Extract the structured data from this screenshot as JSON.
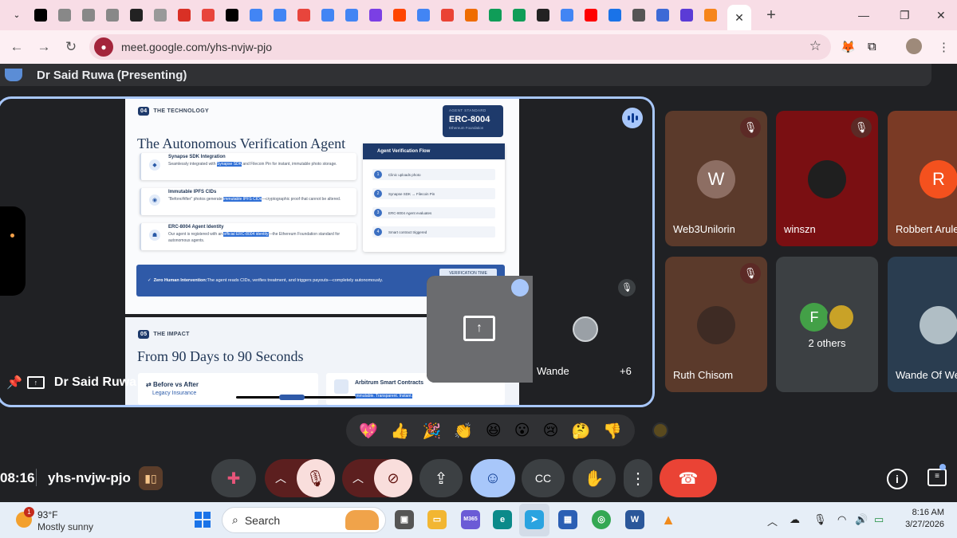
{
  "browser": {
    "url": "meet.google.com/yhs-nvjw-pjo",
    "tab_icons": [
      "chevron-down",
      "x-logo",
      "globe",
      "globe",
      "asterisk",
      "tn",
      "link",
      "a",
      "tube",
      "square",
      "doc",
      "doc",
      "tube",
      "doc",
      "doc",
      "shield",
      "reddit",
      "doc",
      "gmail",
      "chart",
      "plus",
      "plus",
      "news",
      "google",
      "youtube",
      "building",
      "globe",
      "cloud",
      "star",
      "fox"
    ],
    "close_label": "✕",
    "newtab_label": "+"
  },
  "meet": {
    "presenter_title": "Dr Said Ruwa (Presenting)",
    "stage_label": "Dr Said Ruwa",
    "self_view": {
      "name": "Wande",
      "more_count": "+6"
    },
    "participants": [
      {
        "name": "Web3Unilorin",
        "initial": "W",
        "bg": "#5b3a2b",
        "avatar_color": "#8d6e63",
        "muted": true
      },
      {
        "name": "winszn",
        "initial": "",
        "bg": "#7a0f12",
        "avatar_color": "#1f1f1f",
        "muted": true
      },
      {
        "name": "Robbert Arule",
        "initial": "R",
        "bg": "#7a3a25",
        "avatar_color": "#f4511e",
        "muted": false
      },
      {
        "name": "Ruth Chisom",
        "initial": "",
        "bg": "#5b3a2b",
        "avatar_color": "#3e2b24",
        "muted": true
      },
      {
        "name": "2 others",
        "initial": "F",
        "bg": "#3c4043",
        "avatar_color": "#43a047",
        "muted": false
      },
      {
        "name": "Wande Of We",
        "initial": "",
        "bg": "#2a3d50",
        "avatar_color": "#b0bec5",
        "muted": false
      }
    ],
    "reactions": [
      "💖",
      "👍",
      "🎉",
      "👏",
      "😆",
      "😮",
      "😢",
      "🤔",
      "👎"
    ],
    "meeting_time": "08:16",
    "meeting_code": "yhs-nvjw-pjo",
    "colors": {
      "accent": "#a8c7fa",
      "end_call": "#ea4335",
      "muted_bg": "#f9dedc",
      "active_blue": "#a8c7fa"
    }
  },
  "slide1": {
    "section_num": "04",
    "section_label": "THE TECHNOLOGY",
    "title": "The Autonomous Verification Agent",
    "badge": {
      "line1": "AGENT STANDARD",
      "line2": "ERC-8004",
      "line3": "Ethereum Foundation"
    },
    "cards": [
      {
        "title": "Synapse SDK Integration",
        "desc_pre": "Seamlessly integrated with ",
        "desc_hl": "Synapse SDK",
        "desc_post": " and Filecoin Pin for instant, immutable photo storage."
      },
      {
        "title": "Immutable IPFS CIDs",
        "desc_pre": "\"Before/After\" photos generate ",
        "desc_hl": "immutable IPFS CIDs",
        "desc_post": "—cryptographic proof that cannot be altered."
      },
      {
        "title": "ERC-8004 Agent Identity",
        "desc_pre": "Our agent is registered with an ",
        "desc_hl": "official ERC-8004 identity",
        "desc_post": "—the Ethereum Foundation standard for autonomous agents."
      }
    ],
    "flow_title": "Agent Verification Flow",
    "flow_steps": [
      "Clinic uploads photo",
      "Synapse SDK → Filecoin Pin",
      "ERC-8004 Agent evaluates",
      "Smart contract triggered"
    ],
    "banner_bold": "Zero Human Intervention:",
    "banner_text": " The agent reads CIDs, verifies treatment, and triggers payouts—completely autonomously.",
    "banner_pill": "VERIFICATION TIME"
  },
  "slide2": {
    "section_num": "05",
    "section_label": "THE IMPACT",
    "title": "From 90 Days to 90 Seconds",
    "left_title": "Before vs After",
    "left_sub": "Legacy Insurance",
    "right_title": "Arbitrum Smart Contracts",
    "right_desc": "Immutable. Transparent. Instant."
  },
  "taskbar": {
    "temp": "93°F",
    "condition": "Mostly sunny",
    "notif_count": "1",
    "search_label": "Search",
    "time": "8:16 AM",
    "date": "3/27/2026"
  }
}
